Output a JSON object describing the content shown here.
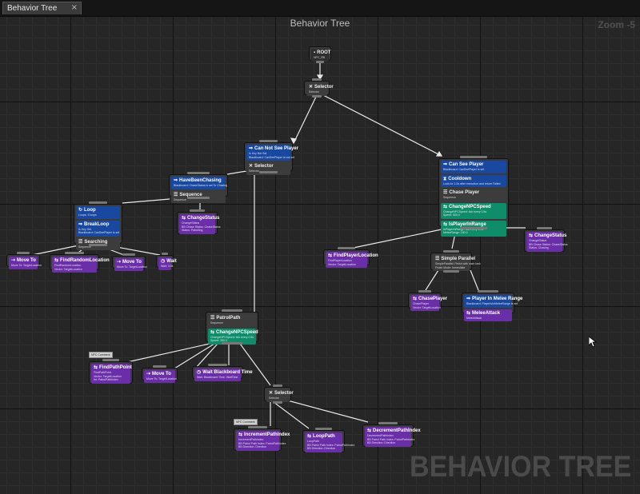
{
  "tab": {
    "label": "Behavior Tree",
    "close": "×"
  },
  "graph": {
    "title": "Behavior Tree",
    "zoom": "Zoom -5",
    "watermark": "BEHAVIOR TREE"
  },
  "nodes": {
    "root": {
      "title": "ROOT",
      "sub": "NPC_BB"
    },
    "selector_top": {
      "title": "Selector",
      "sub": "Selector"
    },
    "cant_see": {
      "dec_title": "Can Not See Player",
      "dec_sub1": "Is Key Not Set",
      "dec_sub2": "Blackboard: CanSeePlayer is not set",
      "comp_title": "Selector",
      "comp_sub": "Selector"
    },
    "can_see": {
      "dec1_title": "Can See Player",
      "dec1_sub": "Blackboard: CanSeePlayer is set",
      "dec2_title": "Cooldown",
      "dec2_sub": "Lock for 1.0s after execution and return Failed",
      "comp_title": "Chase Player",
      "comp_sub": "Sequence",
      "svc1_title": "ChangeNPCSpeed",
      "svc1_sub1": "ChangeNPCSpeed: tick every 0.5s",
      "svc1_sub2": "Speed: 500.0",
      "svc2_title": "IsPlayerInRange",
      "svc2_sub1": "IsPlayerInRange: tick every 0.5s",
      "svc2_sub2": "MeleeRange: 150.0"
    },
    "have_been_chasing": {
      "dec_title": "HaveBeenChasing",
      "dec_sub": "Blackboard: ChaseStatus is set To Chasing",
      "comp_title": "Sequence",
      "comp_sub": "Sequence"
    },
    "change_status_left": {
      "title": "ChangeStatus",
      "sub1": "ChangeStatus",
      "sub2": "BB Chase Status: ChaseStatus",
      "sub3": "Status: Patrolling"
    },
    "loop": {
      "dec1_title": "Loop",
      "dec1_sub": "Loops: 3 loops",
      "dec2_title": "BreakLoop",
      "dec2_sub1": "Is Key Set",
      "dec2_sub2": "Blackboard: CanSeePlayer is set",
      "comp_title": "Searching",
      "comp_sub": "Sequence"
    },
    "move_to_1": {
      "title": "Move To",
      "sub": "Move To: TargetLocation"
    },
    "find_random_location": {
      "title": "FindRandomLocation",
      "sub1": "FindRandomLocation",
      "sub2": "Vector: TargetLocation"
    },
    "move_to_2": {
      "title": "Move To",
      "sub": "Move To: TargetLocation"
    },
    "wait": {
      "title": "Wait",
      "sub": "Wait: 3.0s"
    },
    "find_player_location": {
      "title": "FindPlayerLocation",
      "sub1": "FindPlayerLocation",
      "sub2": "Vector: TargetLocation"
    },
    "simple_parallel": {
      "title": "Simple Parallel",
      "sub1": "SimpleParallel: Finish with main task",
      "sub2": "Finish Mode: Immediate"
    },
    "change_status_right": {
      "title": "ChangeStatus",
      "sub1": "ChangeStatus",
      "sub2": "BB Chase Status: ChaseStatus",
      "sub3": "Status: Chasing"
    },
    "chase_player": {
      "title": "ChasePlayer",
      "sub1": "ChasePlayer",
      "sub2": "Vector: TargetLocation"
    },
    "melee": {
      "dec_title": "Player In Melee Range",
      "dec_sub": "Blackboard: PlayerIsInMeleeRange is set",
      "task_title": "MeleeAttack",
      "task_sub": "MeleeAttack"
    },
    "patrol_path": {
      "comp_title": "PatrolPath",
      "comp_sub": "Sequence",
      "svc_title": "ChangeNPCSpeed",
      "svc_sub1": "ChangeNPCSpeed: tick every 0.5s",
      "svc_sub2": "Speed: 250.0"
    },
    "find_path_point": {
      "title": "FindPathPoint",
      "sub1": "FindPathPoint",
      "sub2": "Vector: TargetLocation",
      "sub3": "Int: PatrolPathIndex",
      "comment": "NPC Comment"
    },
    "move_to_3": {
      "title": "Move To",
      "sub": "Move To: TargetLocation"
    },
    "wait_bb": {
      "title": "Wait Blackboard Time",
      "sub": "Wait: Blackboard Time: WaitTime"
    },
    "selector_bottom": {
      "title": "Selector",
      "sub": "Selector"
    },
    "increment_path": {
      "title": "IncrementPathIndex",
      "sub1": "IncrementPathIndex",
      "sub2": "BB Patrol Path Index: PatrolPathIndex",
      "sub3": "BB Direction: Direction",
      "comment": "NPC Comment"
    },
    "loop_path": {
      "title": "LoopPath",
      "sub1": "LoopPath",
      "sub2": "BB Patrol Path Index: PatrolPathIndex",
      "sub3": "BB Direction: Direction"
    },
    "decrement_path": {
      "title": "DecrementPathIndex",
      "sub1": "DecrementPathIndex",
      "sub2": "BB Patrol Path Index: PatrolPathIndex",
      "sub3": "BB Direction: Direction"
    }
  },
  "colors": {
    "decorator": "#1948a1",
    "service": "#0f8c6a",
    "task": "#6a2ea8",
    "composite": "#3c3c3c",
    "wire": "#e8e8e8"
  },
  "icons": {
    "composite": "selector-icon",
    "decorator": "decorator-icon",
    "service": "service-icon",
    "task": "task-icon"
  }
}
